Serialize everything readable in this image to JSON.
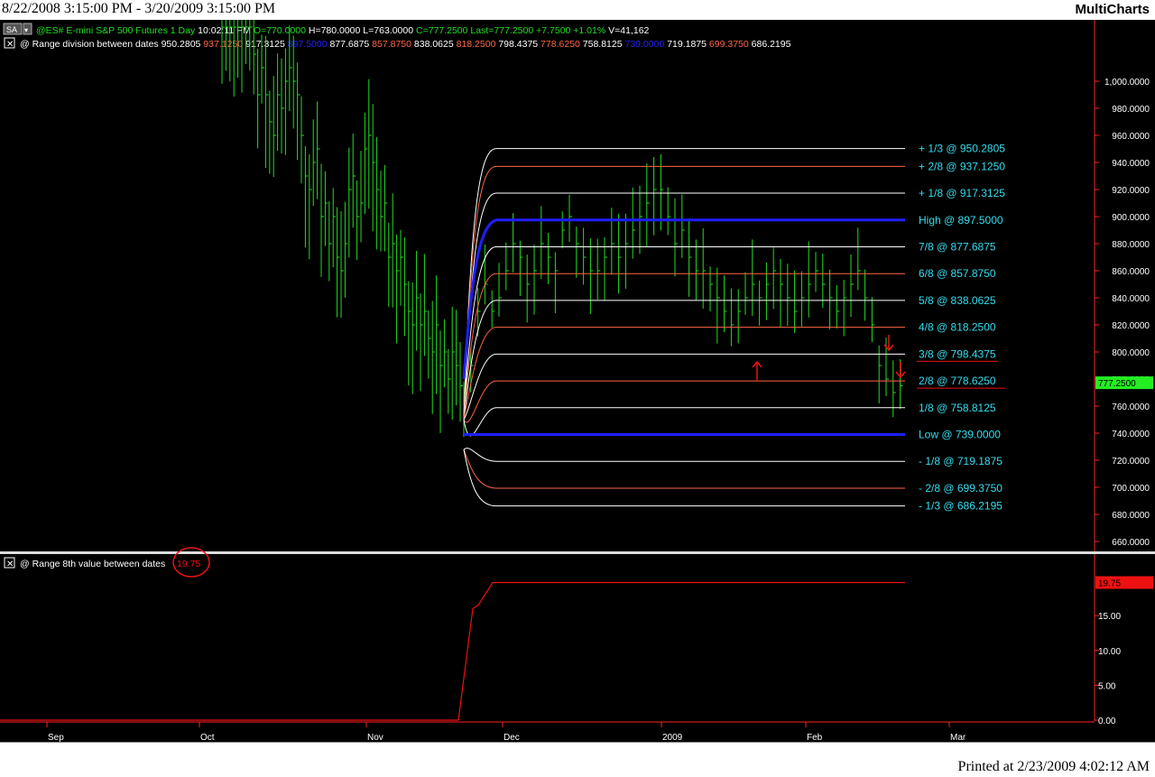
{
  "window": {
    "date_range": "8/22/2008 3:15:00 PM - 3/20/2009 3:15:00 PM",
    "app_name": "MultiCharts",
    "printed": "Printed at 2/23/2009 4:02:12 AM"
  },
  "colors": {
    "background": "#000000",
    "bars": "#22dd22",
    "range_high_low": "#1f1fff",
    "white_level": "#ffffff",
    "red_level": "#ff6644",
    "label_cyan": "#33ddee",
    "indicator_line": "#ee1111",
    "last_price_bg": "#22ee22"
  },
  "legend": {
    "symbol_button": "SA",
    "symbol": "@ES#",
    "description": "E-mini S&P 500 Futures",
    "timeframe": "1 Day",
    "time": "10:02:11 PM",
    "ohlc": [
      {
        "text": "O=770.0000",
        "color": "#22dd22"
      },
      {
        "text": "H=780.0000",
        "color": "#ffffff"
      },
      {
        "text": "L=763.0000",
        "color": "#ffffff"
      },
      {
        "text": "C=777.2500",
        "color": "#22dd22"
      },
      {
        "text": "Last=777.2500",
        "color": "#22dd22"
      },
      {
        "text": "+7.7500",
        "color": "#22dd22"
      },
      {
        "text": "+1.01%",
        "color": "#22dd22"
      },
      {
        "text": "V=41,162",
        "color": "#ffffff"
      }
    ],
    "study_name": "@ Range division between dates",
    "study_values": [
      {
        "text": "950.2805",
        "color": "#ffffff"
      },
      {
        "text": "937.1250",
        "color": "#ff6644"
      },
      {
        "text": "917.3125",
        "color": "#ffffff"
      },
      {
        "text": "897.5000",
        "color": "#2222ff"
      },
      {
        "text": "877.6875",
        "color": "#ffffff"
      },
      {
        "text": "857.8750",
        "color": "#ff6644"
      },
      {
        "text": "838.0625",
        "color": "#ffffff"
      },
      {
        "text": "818.2500",
        "color": "#ff6644"
      },
      {
        "text": "798.4375",
        "color": "#ffffff"
      },
      {
        "text": "778.6250",
        "color": "#ff6644"
      },
      {
        "text": "758.8125",
        "color": "#ffffff"
      },
      {
        "text": "739.0000",
        "color": "#2222ff"
      },
      {
        "text": "719.1875",
        "color": "#ffffff"
      },
      {
        "text": "699.3750",
        "color": "#ff6644"
      },
      {
        "text": "686.2195",
        "color": "#ffffff"
      }
    ],
    "indicator_name": "@ Range 8th value between dates",
    "indicator_value": "19.75"
  },
  "price_axis": [
    "1,000.0000",
    "980.0000",
    "960.0000",
    "940.0000",
    "920.0000",
    "900.0000",
    "880.0000",
    "860.0000",
    "840.0000",
    "820.0000",
    "800.0000",
    "780.0000",
    "760.0000",
    "740.0000",
    "720.0000",
    "700.0000",
    "680.0000",
    "660.0000"
  ],
  "last_price_label": "777.2500",
  "indicator_axis": [
    "15.00",
    "10.00",
    "5.00",
    "0.00"
  ],
  "indicator_value_label": "19.75",
  "time_axis": [
    "Sep",
    "Oct",
    "Nov",
    "Dec",
    "2009",
    "Feb",
    "Mar"
  ],
  "levels": [
    {
      "label": "+ 1/3 @ 950.2805",
      "value": 950.2805,
      "kind": "white"
    },
    {
      "label": "+ 2/8 @ 937.1250",
      "value": 937.125,
      "kind": "red"
    },
    {
      "label": "+ 1/8 @ 917.3125",
      "value": 917.3125,
      "kind": "white"
    },
    {
      "label": "High @ 897.5000",
      "value": 897.5,
      "kind": "blue"
    },
    {
      "label": "7/8 @ 877.6875",
      "value": 877.6875,
      "kind": "white"
    },
    {
      "label": "6/8 @ 857.8750",
      "value": 857.875,
      "kind": "red"
    },
    {
      "label": "5/8 @ 838.0625",
      "value": 838.0625,
      "kind": "white"
    },
    {
      "label": "4/8 @ 818.2500",
      "value": 818.25,
      "kind": "red"
    },
    {
      "label": "3/8 @ 798.4375",
      "value": 798.4375,
      "kind": "white"
    },
    {
      "label": "2/8 @ 778.6250",
      "value": 778.625,
      "kind": "red"
    },
    {
      "label": "1/8 @ 758.8125",
      "value": 758.8125,
      "kind": "white"
    },
    {
      "label": "Low @ 739.0000",
      "value": 739.0,
      "kind": "blue"
    },
    {
      "label": "- 1/8 @ 719.1875",
      "value": 719.1875,
      "kind": "white"
    },
    {
      "label": "- 2/8 @ 699.3750",
      "value": 699.375,
      "kind": "red"
    },
    {
      "label": "- 1/3 @ 686.2195",
      "value": 686.2195,
      "kind": "white"
    }
  ]
}
